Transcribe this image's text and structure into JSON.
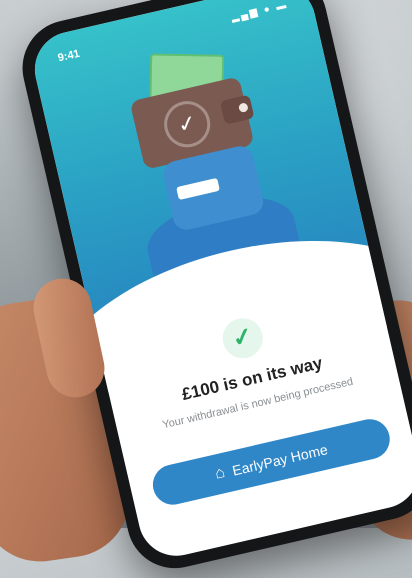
{
  "status_bar": {
    "time": "9:41",
    "icons": "▂▄▆ ● ▬"
  },
  "illustration": {
    "wallet_icon": "wallet-with-checkmark",
    "check_glyph": "✓"
  },
  "confirmation": {
    "icon": "checkmark-icon",
    "check_glyph": "✓",
    "title": "£100 is on its way",
    "subtitle": "Your withdrawal is now being processed"
  },
  "actions": {
    "home_label": "EarlyPay Home",
    "home_icon_glyph": "⌂"
  },
  "colors": {
    "accent": "#2f87c8",
    "hero_top": "#36c1c9",
    "success": "#2db368"
  }
}
